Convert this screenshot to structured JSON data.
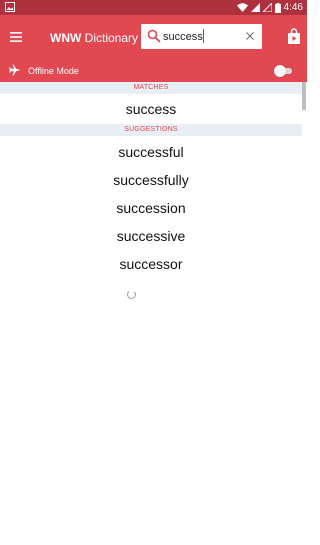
{
  "status_bar": {
    "time": "4:46",
    "icons": [
      "photo-icon",
      "wifi-icon",
      "signal-icon",
      "signal-no-data-icon",
      "battery-icon"
    ]
  },
  "app_bar": {
    "title_brand": "WNW",
    "title_rest": " Dictionary",
    "search": {
      "value": "success",
      "placeholder": ""
    },
    "icons": [
      "menu-icon",
      "search-icon",
      "clear-icon",
      "shopping-bag-icon"
    ]
  },
  "mode_bar": {
    "label": "Offline Mode",
    "offline_enabled": false,
    "icons": [
      "airplane-icon"
    ]
  },
  "results": {
    "matches_header": "MATCHES",
    "matches": [
      "success"
    ],
    "suggestions_header": "SUGGESTIONS",
    "suggestions": [
      "successful",
      "successfully",
      "succession",
      "successive",
      "successor"
    ]
  },
  "colors": {
    "status_bar": "#b0313e",
    "app_bar": "#e14852",
    "section_header_bg": "#e8eef4",
    "section_header_text": "#e14852"
  }
}
